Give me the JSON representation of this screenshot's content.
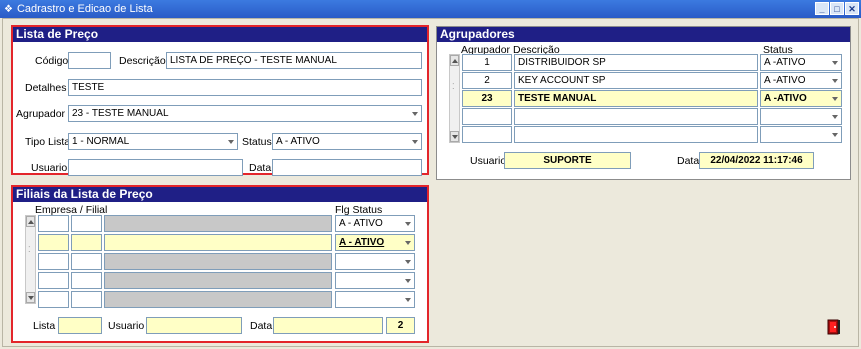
{
  "window": {
    "title": "Cadrastro e Edicao de Lista"
  },
  "lista": {
    "header": "Lista de Preço",
    "codigo_label": "Código",
    "codigo_value": "",
    "descricao_label": "Descrição",
    "descricao_value": "LISTA DE PREÇO - TESTE MANUAL",
    "detalhes_label": "Detalhes",
    "detalhes_value": "TESTE",
    "agrupador_label": "Agrupador",
    "agrupador_value": "23 - TESTE MANUAL",
    "tipo_label": "Tipo Lista",
    "tipo_value": "1 - NORMAL",
    "status_label": "Status",
    "status_value": "A - ATIVO",
    "usuario_label": "Usuario",
    "usuario_value": "",
    "data_label": "Data",
    "data_value": ""
  },
  "agrupadores": {
    "header": "Agrupadores",
    "col_agrupador": "Agrupador",
    "col_descricao": "Descrição",
    "col_status": "Status",
    "rows": [
      {
        "agrupador": "1",
        "descricao": "DISTRIBUIDOR SP",
        "status": "A -ATIVO"
      },
      {
        "agrupador": "2",
        "descricao": "KEY ACCOUNT SP",
        "status": "A -ATIVO"
      },
      {
        "agrupador": "23",
        "descricao": "TESTE MANUAL",
        "status": "A -ATIVO"
      },
      {
        "agrupador": "",
        "descricao": "",
        "status": ""
      },
      {
        "agrupador": "",
        "descricao": "",
        "status": ""
      }
    ],
    "usuario_label": "Usuario",
    "usuario_value": "SUPORTE",
    "data_label": "Data",
    "data_value": "22/04/2022 11:17:46"
  },
  "filiais": {
    "header": "Filiais da Lista de Preço",
    "col_empresa": "Empresa / Filial",
    "col_status": "Flg Status",
    "rows": [
      {
        "status": "A - ATIVO"
      },
      {
        "status": "A - ATIVO"
      },
      {
        "status": ""
      },
      {
        "status": ""
      },
      {
        "status": ""
      }
    ],
    "lista_label": "Lista",
    "lista_value": "",
    "usuario_label": "Usuario",
    "usuario_value": "",
    "data_label": "Data",
    "data_value": "",
    "count_value": "2"
  },
  "colors": {
    "header_bg": "#1f1f86",
    "highlight": "#ffffc6",
    "panel_border": "#e3252b"
  }
}
